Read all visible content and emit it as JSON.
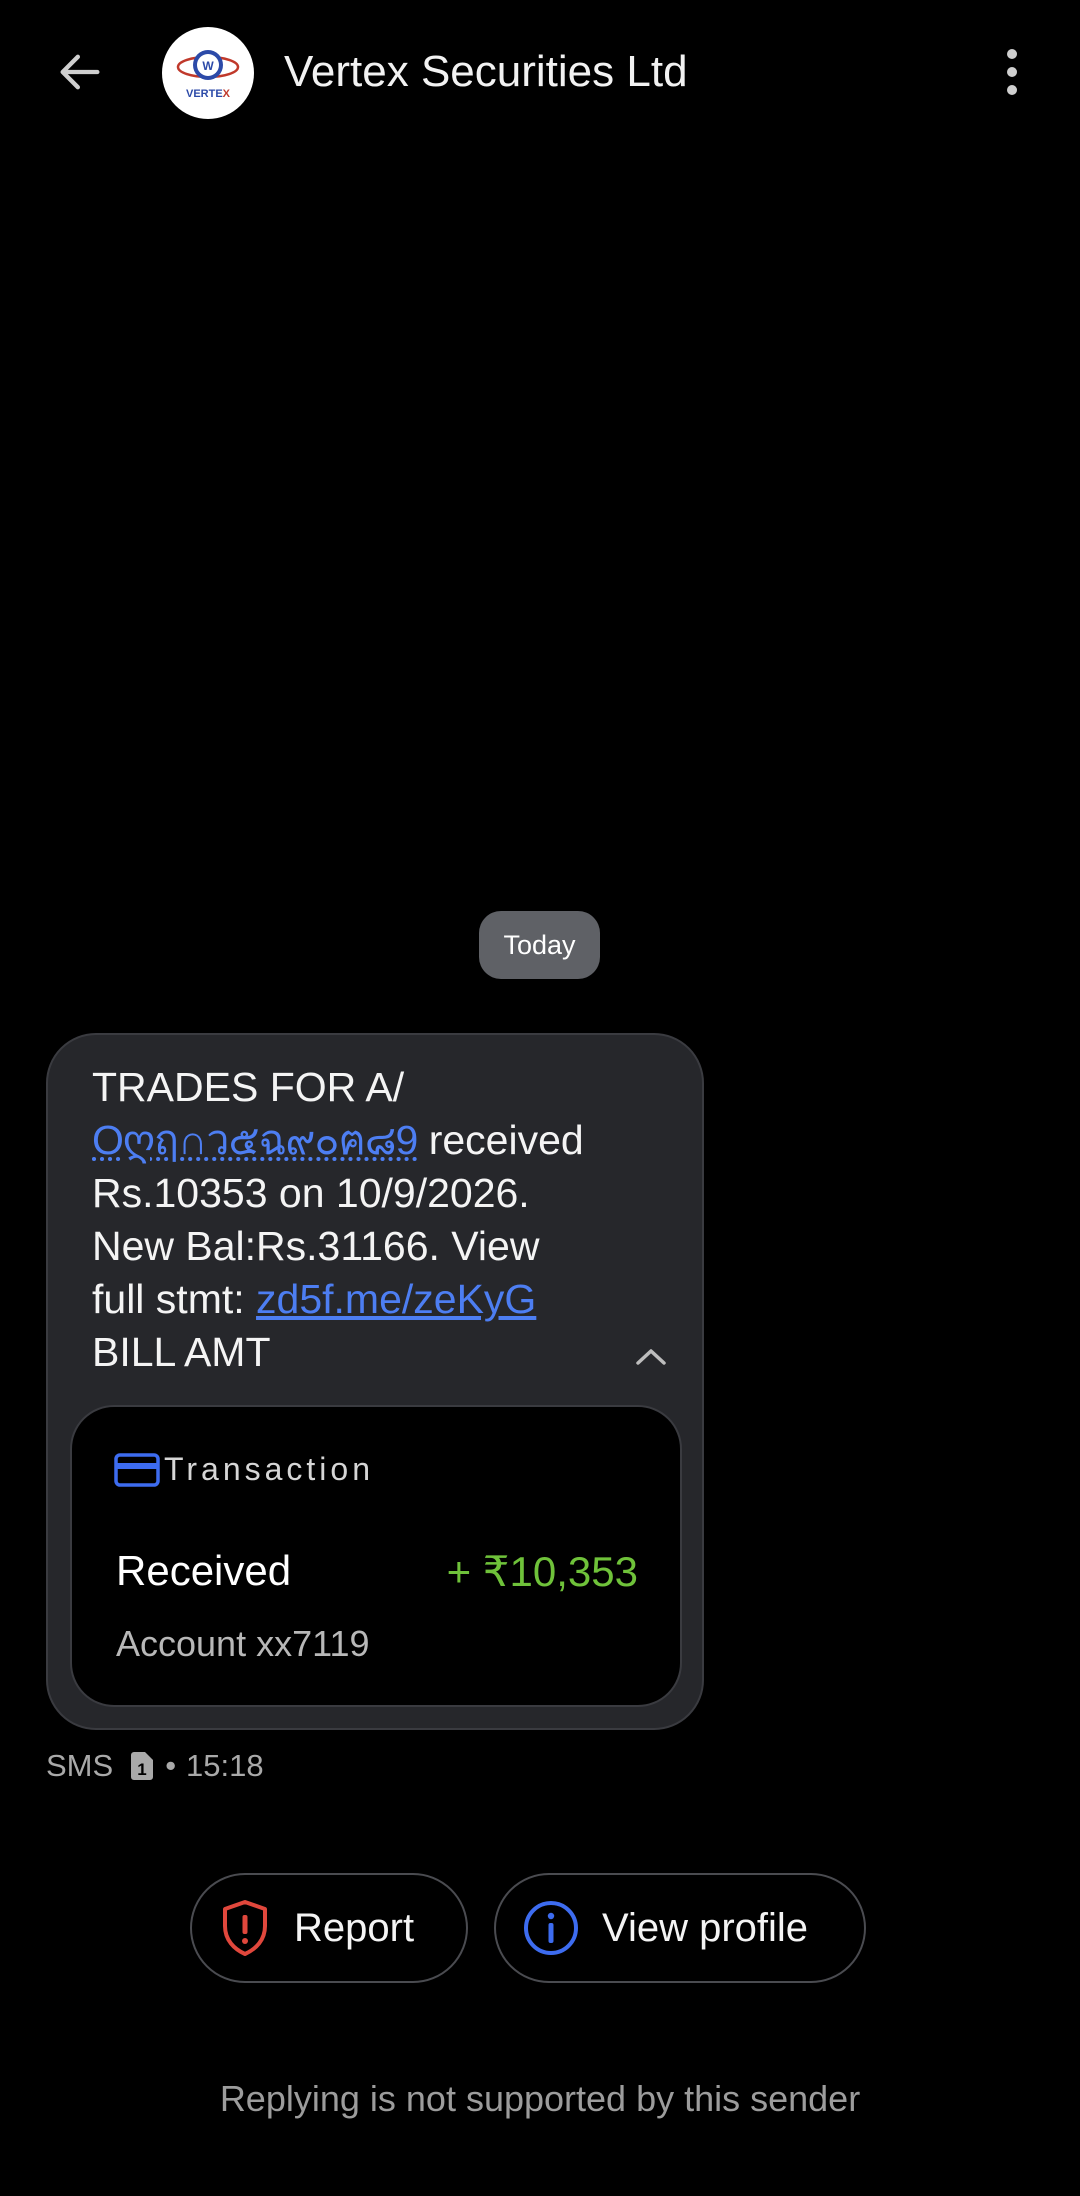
{
  "header": {
    "sender_name": "Vertex Securities Ltd",
    "avatar_logo_text": "VERTEX",
    "back_icon": "arrow-left-icon",
    "menu_icon": "more-vertical-icon"
  },
  "date_separator": "Today",
  "message": {
    "line1": "TRADES FOR A/",
    "account_masked": "Oღฤ∩ว๕ฉ๙๐ฅ๘9",
    "line2_suffix": " received",
    "line3": "Rs.10353 on 10/9/2026.",
    "line4": "New Bal:Rs.31166. View",
    "line5_prefix": "full stmt: ",
    "link": "zd5f.me/zeKyG",
    "line6": "BILL AMT",
    "collapse_icon": "chevron-up-icon"
  },
  "transaction_card": {
    "label": "Transaction",
    "icon": "card-icon",
    "type": "Received",
    "amount": "+ ₹10,353",
    "account": "Account xx7119",
    "colors": {
      "amount": "#6fc23a",
      "icon": "#3d6cf0"
    }
  },
  "meta": {
    "channel": "SMS",
    "sim_icon": "sim-1-icon",
    "time": "15:18"
  },
  "actions": {
    "report_label": "Report",
    "report_icon": "shield-alert-icon",
    "view_profile_label": "View profile",
    "view_profile_icon": "info-icon"
  },
  "footer_note": "Replying is not supported by this sender"
}
